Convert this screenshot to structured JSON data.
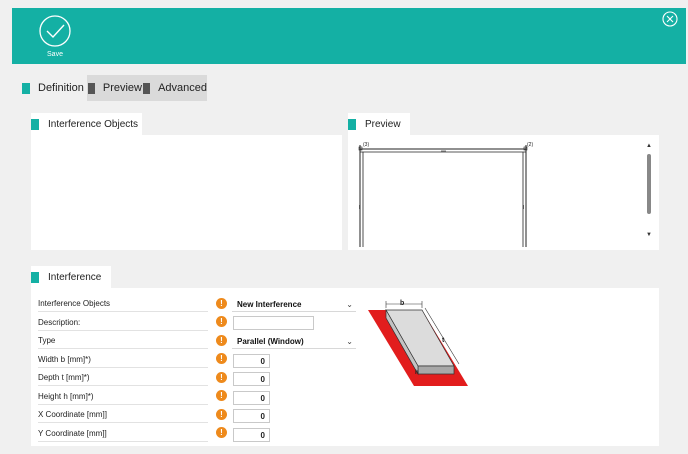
{
  "toolbar": {
    "save_label": "Save",
    "accent_color": "#14b0a4"
  },
  "tabs": [
    {
      "label": "Definition",
      "active": true
    },
    {
      "label": "Preview",
      "active": false
    },
    {
      "label": "Advanced",
      "active": false
    }
  ],
  "panels": {
    "objects_title": "Interference Objects",
    "preview_title": "Preview",
    "interference_title": "Interference"
  },
  "preview": {
    "left_marker": "(3)",
    "right_marker": "(2)"
  },
  "properties": [
    {
      "label": "Interference Objects",
      "value": "New Interference",
      "kind": "select"
    },
    {
      "label": "Description:",
      "value": "",
      "kind": "text"
    },
    {
      "label": "Type",
      "value": "Parallel (Window)",
      "kind": "select"
    },
    {
      "label": "Width b [mm]*)",
      "value": "0",
      "kind": "number"
    },
    {
      "label": "Depth t [mm]*)",
      "value": "0",
      "kind": "number"
    },
    {
      "label": "Height h [mm]*)",
      "value": "0",
      "kind": "number"
    },
    {
      "label": "X Coordinate [mm]]",
      "value": "0",
      "kind": "number"
    },
    {
      "label": "Y Coordinate [mm]]",
      "value": "0",
      "kind": "number"
    }
  ],
  "diagram": {
    "b_label": "b",
    "t_label": "t",
    "h_label": "h",
    "highlight_color": "#e21d1d"
  },
  "icons": {
    "save": "check-circle-icon",
    "close": "close-circle-icon",
    "info": "info-icon",
    "dropdown": "chevron-down-icon"
  },
  "colors": {
    "tab_inactive_swatch": "#555555",
    "info": "#ee8a1c"
  }
}
